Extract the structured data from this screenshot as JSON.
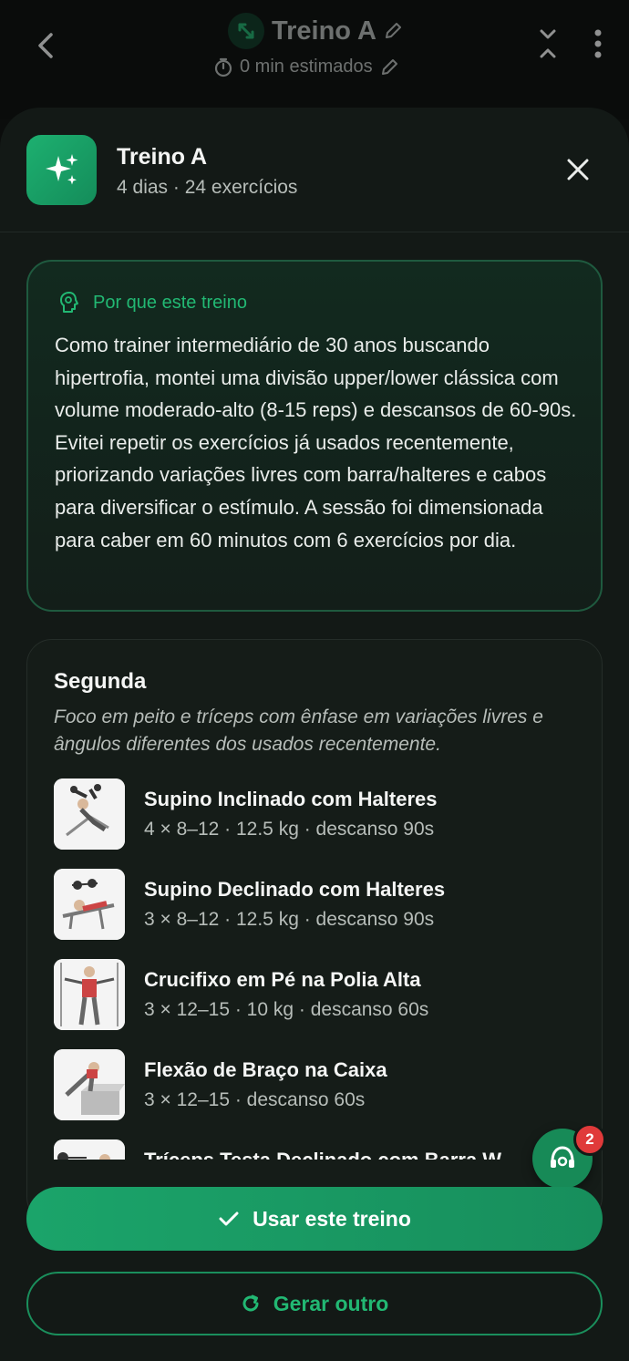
{
  "background_header": {
    "title": "Treino A",
    "subtitle": "0 min estimados"
  },
  "sheet": {
    "title": "Treino A",
    "subtitle": "4 dias · 24 exercícios"
  },
  "why": {
    "label": "Por que este treino",
    "text": "Como trainer intermediário de 30 anos buscando hipertrofia, montei uma divisão upper/lower clássica com volume moderado-alto (8-15 reps) e descansos de 60-90s. Evitei repetir os exercícios já usados recentemente, priorizando variações livres com barra/halteres e cabos para diversificar o estímulo. A sessão foi dimensionada para caber em 60 minutos com 6 exercícios por dia."
  },
  "day": {
    "title": "Segunda",
    "description": "Foco em peito e tríceps com ênfase em variações livres e ângulos diferentes dos usados recentemente.",
    "exercises": [
      {
        "name": "Supino Inclinado com Halteres",
        "detail": "4 × 8–12 · 12.5 kg · descanso 90s"
      },
      {
        "name": "Supino Declinado com Halteres",
        "detail": "3 × 8–12 · 12.5 kg · descanso 90s"
      },
      {
        "name": "Crucifixo em Pé na Polia Alta",
        "detail": "3 × 12–15 · 10 kg · descanso 60s"
      },
      {
        "name": "Flexão de Braço na Caixa",
        "detail": "3 × 12–15 · descanso 60s"
      },
      {
        "name": "Tríceps Testa Declinado com Barra W",
        "detail": ""
      }
    ]
  },
  "fab": {
    "badge": "2"
  },
  "actions": {
    "use_label": "Usar este treino",
    "again_label": "Gerar outro"
  },
  "colors": {
    "accent": "#1ba46a",
    "accent_text": "#22b873",
    "sheet_bg": "#131916",
    "badge": "#e03a3a"
  }
}
